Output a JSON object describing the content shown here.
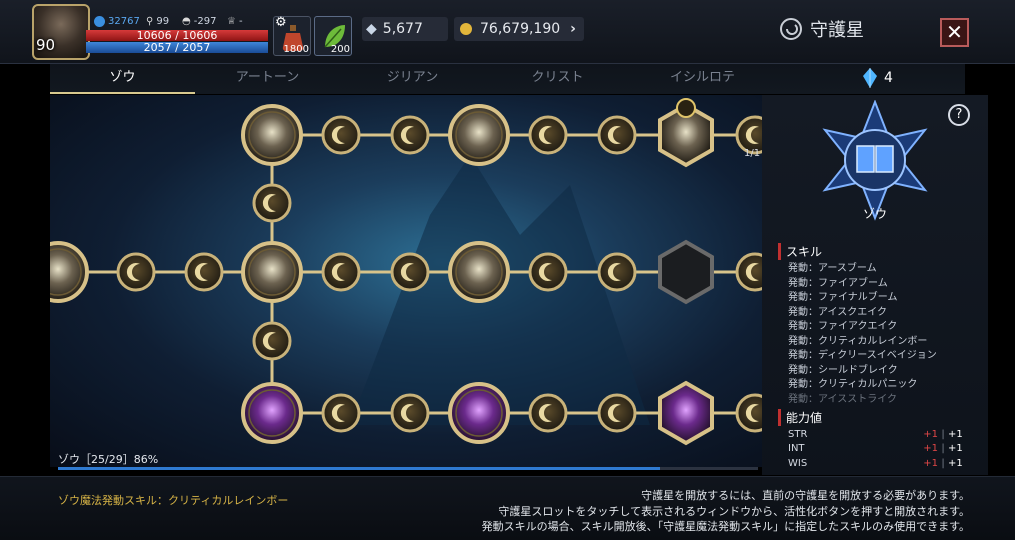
{
  "player": {
    "level": "90",
    "combat_power": "32767",
    "keys": "99",
    "helmet": "-297",
    "trophy": "-",
    "hp": "10606 / 10606",
    "mp": "2057 / 2057"
  },
  "potions": [
    {
      "name": "hp-potion",
      "count": "1800"
    },
    {
      "name": "herb",
      "count": "200"
    }
  ],
  "currency": {
    "crystals": "5,677",
    "gold": "76,679,190"
  },
  "window": {
    "title": "守護星",
    "close": "✕"
  },
  "tabs": [
    "ゾウ",
    "アートーン",
    "ジリアン",
    "クリスト",
    "イシルロテ"
  ],
  "stardust_count": "4",
  "tree": {
    "progress_label": "ゾウ［25/29］86%",
    "progress_percent": 86,
    "counter": "1/1"
  },
  "side": {
    "help": "?",
    "constellation_name": "ゾウ",
    "skills_title": "スキル",
    "skills": [
      {
        "label": "発動：アースブーム",
        "active": true
      },
      {
        "label": "発動：ファイアブーム",
        "active": true
      },
      {
        "label": "発動：ファイナルブーム",
        "active": true
      },
      {
        "label": "発動：アイスクエイク",
        "active": true
      },
      {
        "label": "発動：ファイアクエイク",
        "active": true
      },
      {
        "label": "発動：クリティカルレインボー",
        "active": true
      },
      {
        "label": "発動：ディクリースイベイジョン",
        "active": true
      },
      {
        "label": "発動：シールドブレイク",
        "active": true
      },
      {
        "label": "発動：クリティカルパニック",
        "active": true
      },
      {
        "label": "発動：アイスストライク",
        "active": false
      }
    ],
    "stats_title": "能力値",
    "stats": [
      {
        "name": "STR",
        "bonus": "+1",
        "total": "+1"
      },
      {
        "name": "INT",
        "bonus": "+1",
        "total": "+1"
      },
      {
        "name": "WIS",
        "bonus": "+1",
        "total": "+1"
      }
    ]
  },
  "footer": {
    "active_skill": "ゾウ魔法発動スキル：クリティカルレインボー",
    "notes": [
      "守護星を開放するには、直前の守護星を開放する必要があります。",
      "守護星スロットをタッチして表示されるウィンドウから、活性化ボタンを押すと開放されます。",
      "発動スキルの場合、スキル開放後、「守護星魔法発動スキル」に指定したスキルのみ使用できます。"
    ]
  },
  "colors": {
    "accent_gold": "#d7b446",
    "bonus_red": "#e04747",
    "progress_blue": "#2f7ad1"
  }
}
